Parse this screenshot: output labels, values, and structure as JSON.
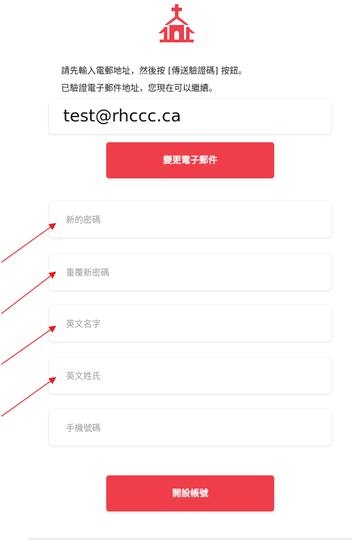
{
  "instructions": {
    "line1": "請先輸入電郵地址，然後按 [傳送驗證碼] 按鈕。",
    "line2": "已驗證電子郵件地址，您現在可以繼續。"
  },
  "email": {
    "value": "test@rhccc.ca"
  },
  "change_email_button": {
    "label": "變更電子郵件"
  },
  "fields": {
    "new_password": {
      "placeholder": "新的密碼"
    },
    "repeat_password": {
      "placeholder": "重覆新密碼"
    },
    "first_name": {
      "placeholder": "英文名字"
    },
    "last_name": {
      "placeholder": "英文姓氏"
    },
    "phone": {
      "placeholder": "手機號碼"
    }
  },
  "create_account_button": {
    "label": "開設帳號"
  },
  "colors": {
    "accent": "#ef3e4a",
    "arrow": "#e02020"
  },
  "icons": {
    "logo": "church-logo-icon"
  }
}
